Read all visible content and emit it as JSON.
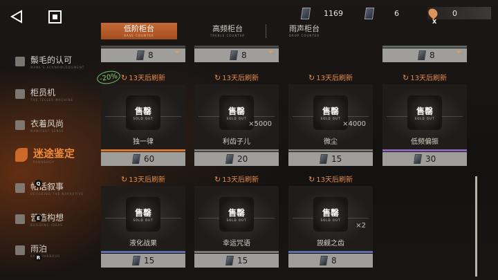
{
  "currency": [
    {
      "icon": "card-currency-icon",
      "value": "1169"
    },
    {
      "icon": "ticket-currency-icon",
      "value": "6"
    },
    {
      "icon": "location-pin-icon",
      "value": "0",
      "key_hint": "X"
    }
  ],
  "tabs": [
    {
      "label": "低阶柜台",
      "sub": "BASE COUNTER",
      "active": true
    },
    {
      "label": "高频柜台",
      "sub": "TREBLE COUNTER",
      "active": false
    },
    {
      "label": "雨声柜台",
      "sub": "DROP COUNTER",
      "active": false
    }
  ],
  "sidebar": {
    "items": [
      {
        "label": "鬃毛的认可",
        "sub": "MANE'S ACKNOWLEDGMENT"
      },
      {
        "label": "柜员机",
        "sub": "THE TELLER MACHINE"
      },
      {
        "label": "衣着风尚",
        "sub": "MANIFEST SENSE"
      },
      {
        "label": "迷途鉴定",
        "sub": "PAWNSHOP"
      },
      {
        "label": "帖话叙事",
        "sub": "DECODING THE NARRATIVE"
      },
      {
        "label": "营造构想",
        "sub": "BUILDING IDEAS"
      },
      {
        "label": "雨泊",
        "sub": "RAIN HARBOUR"
      }
    ],
    "key_hints": [
      "Q",
      "E",
      "R"
    ]
  },
  "top_row_prices": [
    "8",
    "8",
    "8"
  ],
  "discount_badge": "-20%",
  "cards": [
    {
      "timer": "13天后刷新",
      "sold_label": "售罄",
      "sold_sub": "SOLD OUT",
      "name": "独一律",
      "qty": "",
      "price": "60",
      "accent": "#d8772e"
    },
    {
      "timer": "13天后刷新",
      "sold_label": "售罄",
      "sold_sub": "SOLD OUT",
      "name": "利齿子儿",
      "qty": "×5000",
      "price": "20",
      "accent": "#7b7a78"
    },
    {
      "timer": "13天后刷新",
      "sold_label": "售罄",
      "sold_sub": "SOLD OUT",
      "name": "微尘",
      "qty": "×4000",
      "price": "15",
      "accent": "#7b7a78"
    },
    {
      "timer": "13天后刷新",
      "sold_label": "售罄",
      "sold_sub": "SOLD OUT",
      "name": "低频偏振",
      "qty": "",
      "price": "30",
      "accent": "#8b66b8"
    },
    {
      "timer": "13天后刷新",
      "sold_label": "售罄",
      "sold_sub": "SOLD OUT",
      "name": "液化战果",
      "qty": "",
      "price": "15",
      "accent": "#5b6fae"
    },
    {
      "timer": "13天后刷新",
      "sold_label": "售罄",
      "sold_sub": "SOLD OUT",
      "name": "幸运咒语",
      "qty": "",
      "price": "15",
      "accent": "#7b7a78"
    },
    {
      "timer": "13天后刷新",
      "sold_label": "售罄",
      "sold_sub": "SOLD OUT",
      "name": "觊觎之齿",
      "qty": "×2",
      "price": "8",
      "accent": "#5b6fae"
    }
  ],
  "colors": {
    "accent_orange": "#e2742e",
    "tab_active": "#b85a2a",
    "timer_text": "#e58a4a",
    "discount_green": "#6ccf6f"
  }
}
